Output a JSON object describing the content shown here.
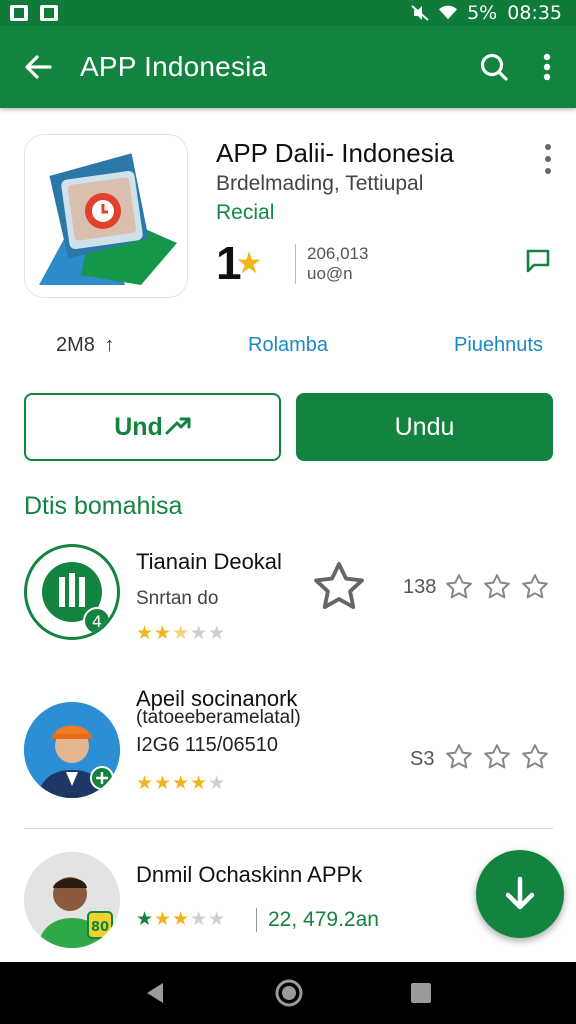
{
  "status_bar": {
    "battery": "5%",
    "time": "08:35"
  },
  "app_bar": {
    "title": "APP Indonesia"
  },
  "app": {
    "name": "APP Dalii- Indonesia",
    "developer": "Brdelmading, Tettiupal",
    "tag": "Recial",
    "rating": "1",
    "count_line1": "206,013",
    "count_line2": "uo@n",
    "size": "2M8",
    "link1": "Rolamba",
    "link2": "Piuehnuts"
  },
  "buttons": {
    "outline_label": "Und",
    "filled_label": "Undu"
  },
  "section": {
    "title": "Dtis bomahisa"
  },
  "list": [
    {
      "title": "Tianain Deokal",
      "sub": "Snrtan do",
      "num": "138"
    },
    {
      "title": "Apeil socinanork",
      "sub": "(tatoeeberamelatal)",
      "sub2": "I2G6 115/06510",
      "num": "S3"
    },
    {
      "title": "Dnmil Ochaskinn APPk",
      "sub": "22, 479.2an"
    }
  ],
  "colors": {
    "primary": "#12843f",
    "star": "#f2b51c",
    "link": "#1b88c8"
  }
}
